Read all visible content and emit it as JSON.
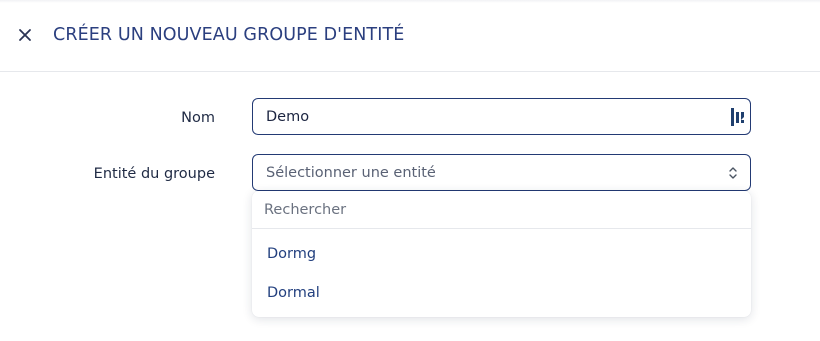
{
  "header": {
    "title": "CRÉER UN NOUVEAU GROUPE D'ENTITÉ",
    "close_icon": "close-icon"
  },
  "form": {
    "name_label": "Nom",
    "name_value": "Demo",
    "name_field_icon": "lastpass-icon",
    "entity_label": "Entité du groupe",
    "entity_placeholder": "Sélectionner une entité",
    "entity_select_icon": "chevron-updown-icon"
  },
  "dropdown": {
    "search_placeholder": "Rechercher",
    "options": [
      {
        "label": "Dormg"
      },
      {
        "label": "Dormal"
      }
    ]
  },
  "colors": {
    "title": "#2b3f7f",
    "field_border": "#233a74",
    "option_text": "#23407f",
    "divider": "#e6e8ec"
  }
}
